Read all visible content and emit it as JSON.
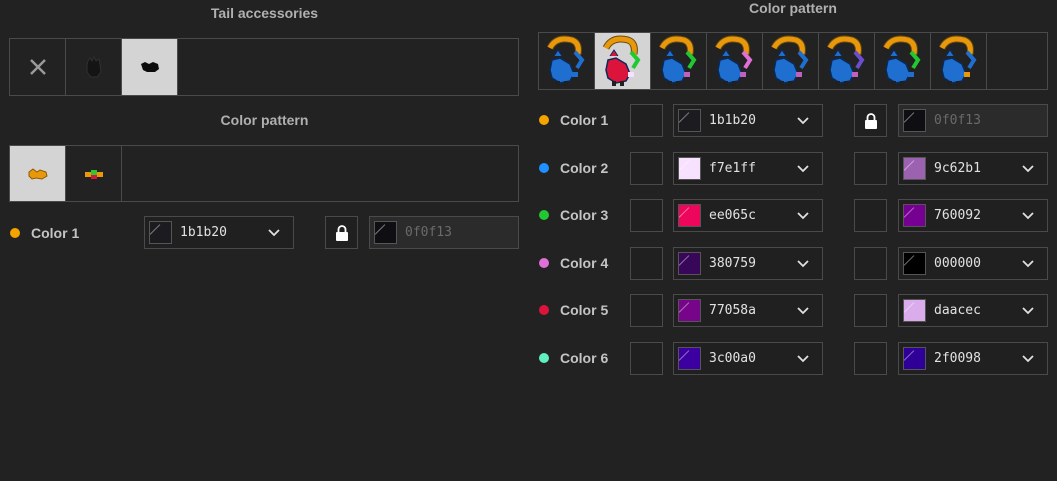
{
  "left": {
    "tail_title": "Tail accessories",
    "pattern_title": "Color pattern",
    "color1": {
      "label": "Color 1",
      "dot": "#f5a300",
      "primary": "1b1b20",
      "secondary": "0f0f13"
    }
  },
  "right": {
    "pattern_title": "Color pattern",
    "rows": [
      {
        "label": "Color 1",
        "dot": "#f5a300",
        "primary": "1b1b20",
        "secondary": "0f0f13",
        "locked": true
      },
      {
        "label": "Color 2",
        "dot": "#1e90ff",
        "primary": "f7e1ff",
        "secondary": "9c62b1",
        "locked": false
      },
      {
        "label": "Color 3",
        "dot": "#22c832",
        "primary": "ee065c",
        "secondary": "760092",
        "locked": false
      },
      {
        "label": "Color 4",
        "dot": "#e070d8",
        "primary": "380759",
        "secondary": "000000",
        "locked": false
      },
      {
        "label": "Color 5",
        "dot": "#dc143c",
        "primary": "77058a",
        "secondary": "daacec",
        "locked": false
      },
      {
        "label": "Color 6",
        "dot": "#60f0c0",
        "primary": "3c00a0",
        "secondary": "2f0098",
        "locked": false
      }
    ]
  }
}
